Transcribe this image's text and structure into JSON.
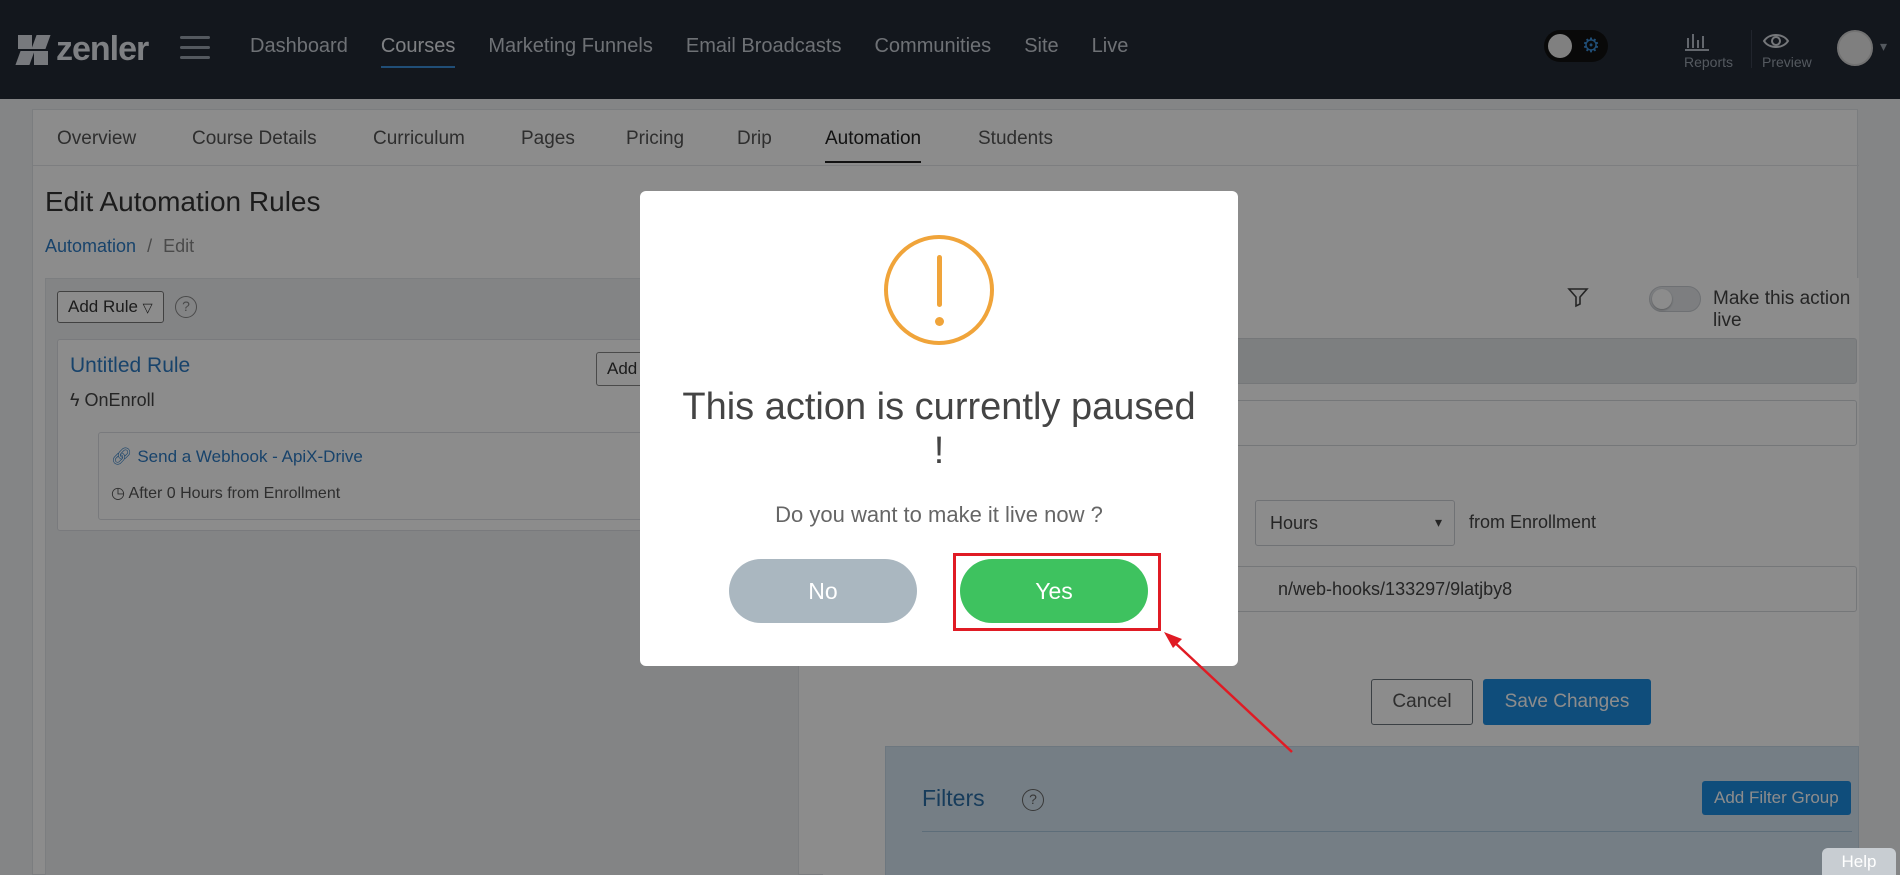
{
  "app": {
    "logo_text": "zenler"
  },
  "nav": {
    "links": [
      "Dashboard",
      "Courses",
      "Marketing Funnels",
      "Email Broadcasts",
      "Communities",
      "Site",
      "Live"
    ],
    "active": "Courses",
    "reports_label": "Reports",
    "preview_label": "Preview"
  },
  "tabs": {
    "items": [
      "Overview",
      "Course Details",
      "Curriculum",
      "Pages",
      "Pricing",
      "Drip",
      "Automation",
      "Students"
    ],
    "active": "Automation"
  },
  "page": {
    "title": "Edit Automation Rules",
    "breadcrumb_link": "Automation",
    "breadcrumb_sep": "/",
    "breadcrumb_current": "Edit"
  },
  "left": {
    "add_rule_label": "Add Rule",
    "help": "?",
    "rule_title": "Untitled Rule",
    "rule_trigger": "OnEnroll",
    "add_action_label": "Add A",
    "action_link": "Send a Webhook - ApiX-Drive",
    "action_delay": "After 0 Hours from Enrollment"
  },
  "right": {
    "live_label": "Make this action live",
    "delay_unit": "Hours",
    "from_label": "from Enrollment",
    "url_visible": "n/web-hooks/133297/9latjby8",
    "cancel_label": "Cancel",
    "save_label": "Save Changes",
    "filters_title": "Filters",
    "filters_help": "?",
    "add_filter_label": "Add Filter Group"
  },
  "modal": {
    "title": "This action is currently paused !",
    "message": "Do you want to make it live now ?",
    "no_label": "No",
    "yes_label": "Yes"
  },
  "help_tab": "Help",
  "colors": {
    "nav_bg": "#232a36",
    "accent": "#1d8ce0",
    "warning": "#f0a43a",
    "yes_green": "#3ec25f",
    "no_gray": "#aab7c0",
    "highlight_red": "#e01b24"
  }
}
